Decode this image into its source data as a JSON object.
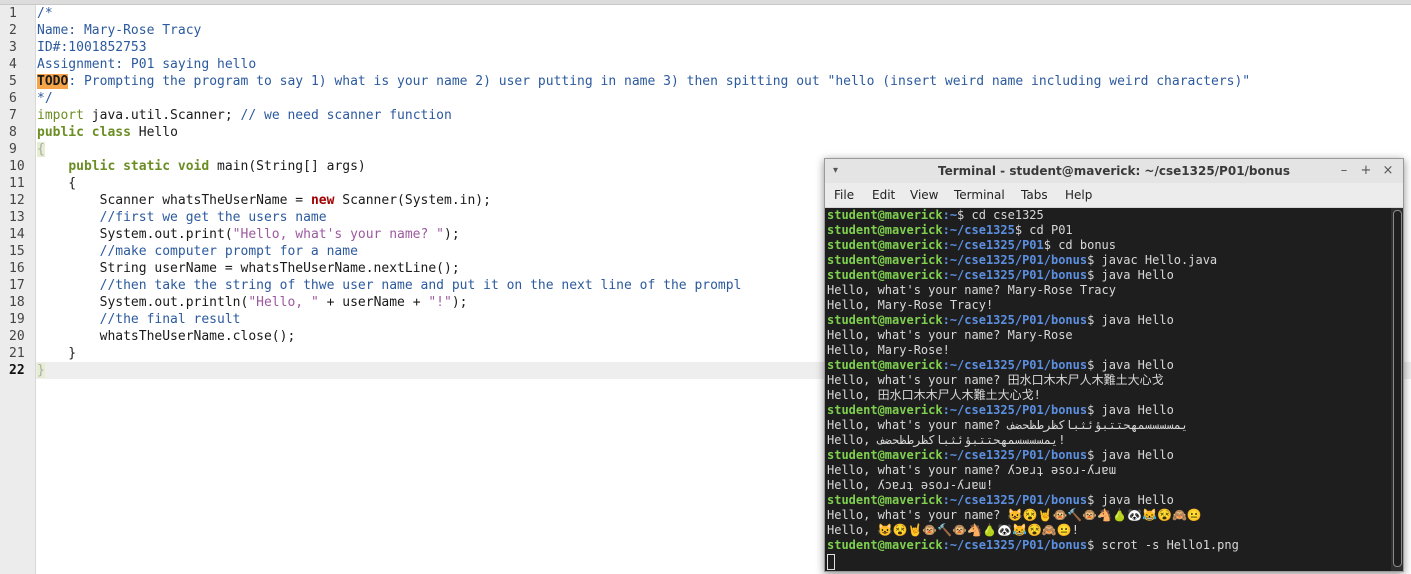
{
  "editor": {
    "line_numbers": [
      "1",
      "2",
      "3",
      "4",
      "5",
      "6",
      "7",
      "8",
      "9",
      "10",
      "11",
      "12",
      "13",
      "14",
      "15",
      "16",
      "17",
      "18",
      "19",
      "20",
      "21",
      "22"
    ],
    "current_line": "22",
    "code": {
      "l1": "/*",
      "l2": "Name: Mary-Rose Tracy",
      "l3": "ID#:1001852753",
      "l4": "Assignment: P01 saying hello",
      "l5_todo": "TODO",
      "l5_rest": ": Prompting the program to say 1) what is your name 2) user putting in name 3) then spitting out \"hello (insert weird name including weird characters)\"",
      "l6": "*/",
      "l7_import": "import",
      "l7_rest": " java.util.Scanner; ",
      "l7_comment": "// we need scanner function",
      "l8_public": "public",
      "l8_class": "class",
      "l8_name": " Hello",
      "l9": "{",
      "l10_indent": "    ",
      "l10_public": "public",
      "l10_static": "static",
      "l10_void": "void",
      "l10_rest": " main(String[] args)",
      "l11": "    {",
      "l12_a": "        Scanner whatsTheUserName = ",
      "l12_new": "new",
      "l12_b": " Scanner(System.in);",
      "l13": "        //first we get the users name",
      "l14_a": "        System.out.print(",
      "l14_str": "\"Hello, what's your name? \"",
      "l14_b": ");",
      "l15": "        //make computer prompt for a name",
      "l16": "        String userName = whatsTheUserName.nextLine();",
      "l17": "        //then take the string of thwe user name and put it on the next line of the prompl",
      "l18_a": "        System.out.println(",
      "l18_s1": "\"Hello, \"",
      "l18_b": " + userName + ",
      "l18_s2": "\"!\"",
      "l18_c": ");",
      "l19": "        //the final result",
      "l20": "        whatsTheUserName.close();",
      "l21": "    }",
      "l22": "}"
    }
  },
  "terminal": {
    "title": "Terminal - student@maverick: ~/cse1325/P01/bonus",
    "window_buttons": {
      "minimize": "–",
      "maximize": "+",
      "close": "×"
    },
    "menu": [
      "File",
      "Edit",
      "View",
      "Terminal",
      "Tabs",
      "Help"
    ],
    "prompt_user": "student@maverick",
    "lines": [
      {
        "type": "prompt",
        "path": ":~",
        "cmd": "$ cd cse1325"
      },
      {
        "type": "prompt",
        "path": ":~/cse1325",
        "cmd": "$ cd P01"
      },
      {
        "type": "prompt",
        "path": ":~/cse1325/P01",
        "cmd": "$ cd bonus"
      },
      {
        "type": "prompt",
        "path": ":~/cse1325/P01/bonus",
        "cmd": "$ javac Hello.java"
      },
      {
        "type": "prompt",
        "path": ":~/cse1325/P01/bonus",
        "cmd": "$ java Hello"
      },
      {
        "type": "out",
        "text": "Hello, what's your name? Mary-Rose Tracy"
      },
      {
        "type": "out",
        "text": "Hello, Mary-Rose Tracy!"
      },
      {
        "type": "prompt",
        "path": ":~/cse1325/P01/bonus",
        "cmd": "$ java Hello"
      },
      {
        "type": "out",
        "text": "Hello, what's your name? Mary-Rose"
      },
      {
        "type": "out",
        "text": "Hello, Mary-Rose!"
      },
      {
        "type": "prompt",
        "path": ":~/cse1325/P01/bonus",
        "cmd": "$ java Hello"
      },
      {
        "type": "out",
        "text": "Hello, what's your name? 田水口木木尸人木難土大心戈"
      },
      {
        "type": "out",
        "text": "Hello, 田水口木木尸人木難土大心戈!"
      },
      {
        "type": "prompt",
        "path": ":~/cse1325/P01/bonus",
        "cmd": "$ java Hello"
      },
      {
        "type": "out",
        "text": "Hello, what's your name? یمسسسسمهحتتبؤئثباكظرطظحضف"
      },
      {
        "type": "out",
        "text": "Hello, یمسسسسمهحتتبؤئثباكظرطظحضف!"
      },
      {
        "type": "prompt",
        "path": ":~/cse1325/P01/bonus",
        "cmd": "$ java Hello"
      },
      {
        "type": "out",
        "text": "Hello, what's your name? ʎɔɐɹʇ ǝsoɹ-ʎɹɐɯ"
      },
      {
        "type": "out",
        "text": "Hello, ʎɔɐɹʇ ǝsoɹ-ʎɹɐɯ!"
      },
      {
        "type": "prompt",
        "path": ":~/cse1325/P01/bonus",
        "cmd": "$ java Hello"
      },
      {
        "type": "out",
        "text": "Hello, what's your name? 😺😵🤘🐵🔨🐵🐴🍐🐼😹😵🙈😐"
      },
      {
        "type": "out",
        "text": "Hello, 😺😵🤘🐵🔨🐵🐴🍐🐼😹😵🙈😐!"
      },
      {
        "type": "prompt",
        "path": ":~/cse1325/P01/bonus",
        "cmd": "$ scrot -s Hello1.png"
      }
    ]
  }
}
